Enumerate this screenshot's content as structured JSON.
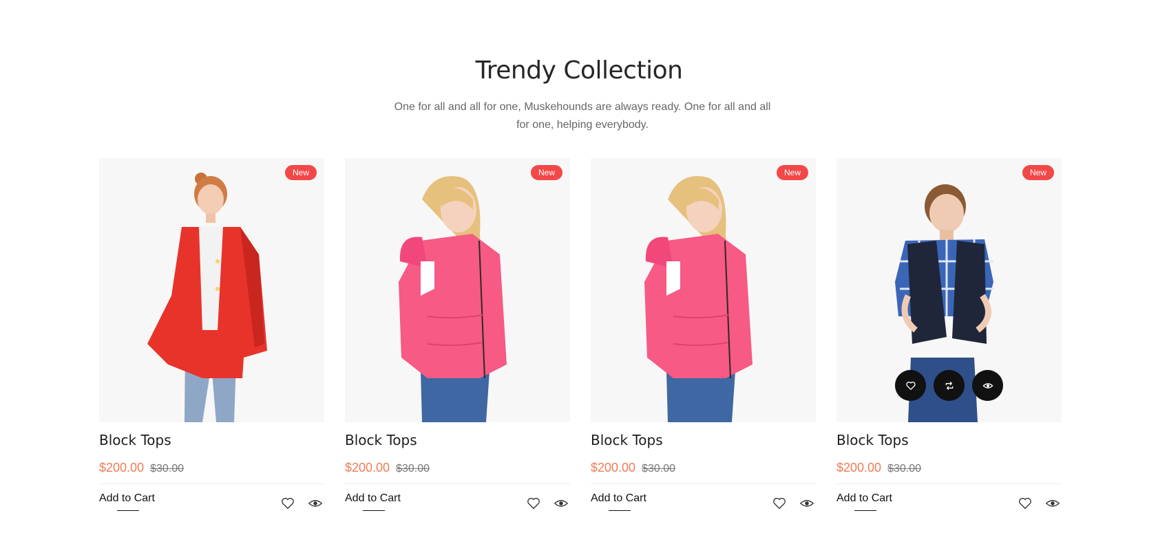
{
  "section": {
    "title": "Trendy Collection",
    "subtitle": "One for all and all for one, Muskehounds are always ready. One for all and all for one, helping everybody."
  },
  "products": [
    {
      "name": "Block Tops",
      "price": "$200.00",
      "old_price": "$30.00",
      "badge": "New",
      "cart_label": "Add to Cart"
    },
    {
      "name": "Block Tops",
      "price": "$200.00",
      "old_price": "$30.00",
      "badge": "New",
      "cart_label": "Add to Cart"
    },
    {
      "name": "Block Tops",
      "price": "$200.00",
      "old_price": "$30.00",
      "badge": "New",
      "cart_label": "Add to Cart"
    },
    {
      "name": "Block Tops",
      "price": "$200.00",
      "old_price": "$30.00",
      "badge": "New",
      "cart_label": "Add to Cart"
    }
  ],
  "icons": {
    "wishlist": "heart-icon",
    "quickview": "eye-icon",
    "compare": "repeat-icon"
  },
  "colors": {
    "badge": "#f24848",
    "price": "#f07b56",
    "action_button": "#111111",
    "image_bg": "#f7f7f7"
  }
}
